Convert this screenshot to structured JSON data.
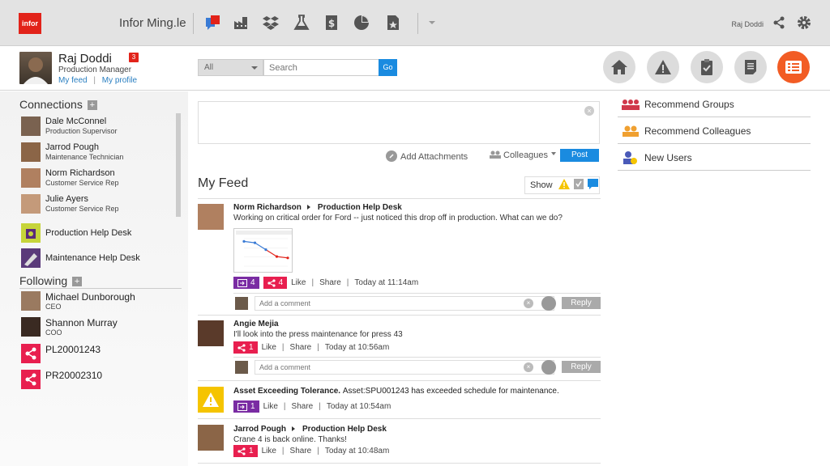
{
  "topbar": {
    "logo": "infor",
    "title": "Infor Ming.le",
    "apps": [
      "chat-icon",
      "factory-icon",
      "dropbox-icon",
      "flask-icon",
      "dollar-doc-icon",
      "pie-chart-icon",
      "starred-doc-icon",
      "chevron-down-icon"
    ],
    "user": "Raj Doddi"
  },
  "profile": {
    "name": "Raj Doddi",
    "role": "Production Manager",
    "my_feed": "My feed",
    "link_sep": "|",
    "my_profile": "My profile",
    "badge": "3"
  },
  "search": {
    "scope": "All",
    "placeholder": "Search",
    "go": "Go"
  },
  "nav_circles": [
    "home-icon",
    "warning-icon",
    "clipboard-check-icon",
    "notes-icon",
    "list-icon"
  ],
  "connections": {
    "title": "Connections",
    "items": [
      {
        "name": "Dale McConnel",
        "role": "Production Supervisor"
      },
      {
        "name": "Jarrod Pough",
        "role": "Maintenance Technician"
      },
      {
        "name": "Norm Richardson",
        "role": "Customer Service Rep"
      },
      {
        "name": "Julie Ayers",
        "role": "Customer Service Rep"
      }
    ],
    "groups": [
      "Production Help Desk",
      "Maintenance Help Desk"
    ]
  },
  "following": {
    "title": "Following",
    "items": [
      {
        "name": "Michael Dunborough",
        "role": "CEO"
      },
      {
        "name": "Shannon Murray",
        "role": "COO"
      },
      {
        "name": "PL20001243",
        "role": ""
      },
      {
        "name": "PR20002310",
        "role": ""
      }
    ]
  },
  "composer": {
    "attach": "Add Attachments",
    "audience": "Colleagues",
    "post": "Post"
  },
  "feed": {
    "title": "My Feed",
    "show": "Show",
    "like": "Like",
    "share": "Share",
    "reply": "Reply",
    "comment_placeholder": "Add a comment",
    "posts": [
      {
        "author": "Norm Richardson",
        "target": "Production Help Desk",
        "text": "Working on critical order for Ford -- just noticed this drop off in production. What can we do?",
        "tasks": "4",
        "shares": "4",
        "time": "Today at 11:14am"
      },
      {
        "author": "Angie Mejia",
        "target": "",
        "text": "I'll look into the press maintenance for press 43",
        "tasks": "",
        "shares": "1",
        "time": "Today at 10:56am"
      },
      {
        "author": "Asset Exceeding Tolerance.",
        "target": "",
        "text": "Asset:SPU001243 has exceeded schedule for maintenance.",
        "tasks": "1",
        "shares": "",
        "time": "Today at 10:54am"
      },
      {
        "author": "Jarrod Pough",
        "target": "Production Help Desk",
        "text": "Crane 4 is back online. Thanks!",
        "tasks": "",
        "shares": "1",
        "time": "Today at 10:48am"
      }
    ]
  },
  "mini_chart": {
    "values": [
      0.9,
      0.85,
      0.6,
      0.35,
      0.3
    ]
  },
  "right": {
    "items": [
      "Recommend Groups",
      "Recommend Colleagues",
      "New Users"
    ]
  },
  "colors": {
    "accent": "#f25c24",
    "link": "#2a7fc1",
    "button": "#1a8be0",
    "share": "#e81f4f",
    "task": "#7a2ca3"
  }
}
